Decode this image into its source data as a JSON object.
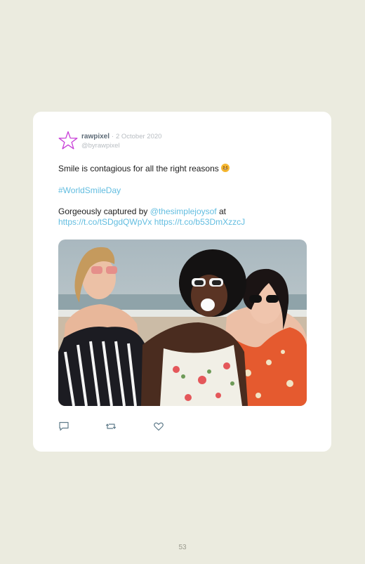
{
  "tweet": {
    "display_name": "rawpixel",
    "separator": "·",
    "date": "2 October 2020",
    "handle": "@byrawpixel",
    "line1": "Smile is contagious for all the right reasons",
    "hashtag": "#WorldSmileDay",
    "credit_prefix": "Gorgeously captured by",
    "mention": "@thesimplejoysof",
    "credit_suffix": "at",
    "link1": "https://t.co/tSDgdQWpVx",
    "link2": "https://t.co/b53DmXzzcJ",
    "avatar_icon": "star-outline-icon",
    "photo_icon": "photo-three-smiling-women-beach",
    "actions": [
      "reply-icon",
      "retweet-icon",
      "like-icon"
    ]
  },
  "footer": {
    "page_number": "53"
  },
  "colors": {
    "page_bg": "#ebebdf",
    "card_bg": "#ffffff",
    "link": "#62bde0",
    "meta": "#b8bdc2",
    "star": "#c83fd8"
  }
}
